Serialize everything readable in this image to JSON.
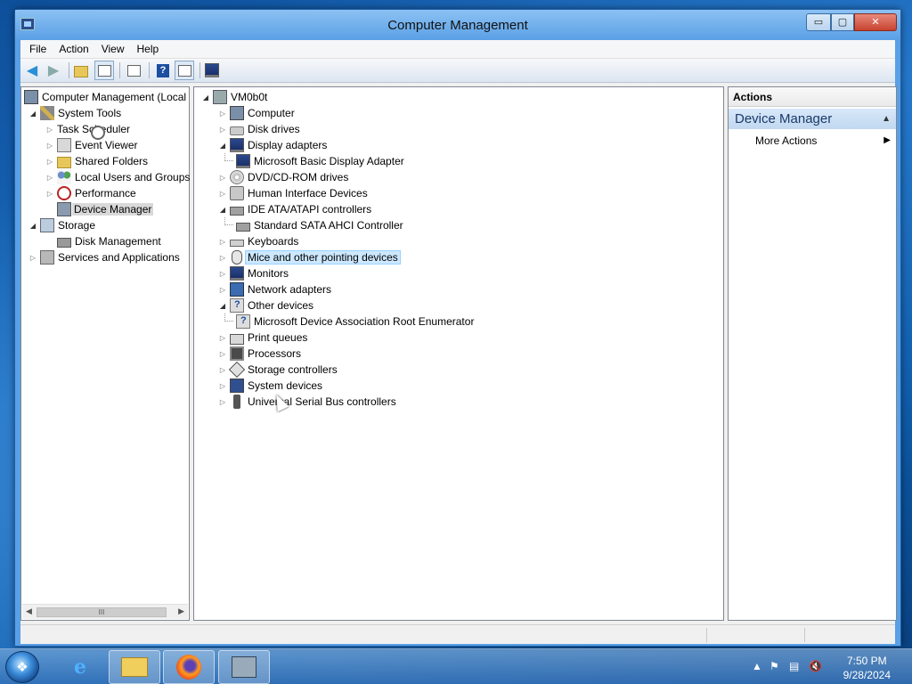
{
  "window": {
    "title": "Computer Management",
    "controls": {
      "minimize": "▭",
      "maximize": "▢",
      "close": "✕"
    }
  },
  "menu": [
    "File",
    "Action",
    "View",
    "Help"
  ],
  "toolbar": {
    "icons": [
      "back-arrow-icon",
      "forward-arrow-icon",
      "up-folder-icon",
      "show-hide-tree-icon",
      "properties-icon",
      "help-icon",
      "show-hide-action-pane-icon",
      "scan-hardware-icon"
    ]
  },
  "left_tree": {
    "root": "Computer Management (Local",
    "system_tools": "System Tools",
    "task_scheduler": "Task Scheduler",
    "event_viewer": "Event Viewer",
    "shared_folders": "Shared Folders",
    "local_users": "Local Users and Groups",
    "performance": "Performance",
    "device_manager": "Device Manager",
    "storage": "Storage",
    "disk_management": "Disk Management",
    "services_apps": "Services and Applications",
    "scroll_thumb": "III"
  },
  "device_tree": {
    "root": "VM0b0t",
    "items": [
      {
        "label": "Computer",
        "state": "collapsed",
        "icon": "computer-icon"
      },
      {
        "label": "Disk drives",
        "state": "collapsed",
        "icon": "disk-drive-icon"
      },
      {
        "label": "Display adapters",
        "state": "expanded",
        "icon": "display-adapter-icon"
      },
      {
        "label": "Microsoft Basic Display Adapter",
        "state": "child",
        "icon": "display-adapter-icon"
      },
      {
        "label": "DVD/CD-ROM drives",
        "state": "collapsed",
        "icon": "dvd-icon"
      },
      {
        "label": "Human Interface Devices",
        "state": "collapsed",
        "icon": "hid-icon"
      },
      {
        "label": "IDE ATA/ATAPI controllers",
        "state": "expanded",
        "icon": "ide-controller-icon"
      },
      {
        "label": "Standard SATA AHCI Controller",
        "state": "child",
        "icon": "ide-controller-icon"
      },
      {
        "label": "Keyboards",
        "state": "collapsed",
        "icon": "keyboard-icon"
      },
      {
        "label": "Mice and other pointing devices",
        "state": "collapsed",
        "icon": "mouse-icon",
        "selected": true
      },
      {
        "label": "Monitors",
        "state": "collapsed",
        "icon": "monitor-icon"
      },
      {
        "label": "Network adapters",
        "state": "collapsed",
        "icon": "network-adapter-icon"
      },
      {
        "label": "Other devices",
        "state": "expanded",
        "icon": "unknown-device-icon"
      },
      {
        "label": "Microsoft Device Association Root Enumerator",
        "state": "child",
        "icon": "unknown-device-icon"
      },
      {
        "label": "Print queues",
        "state": "collapsed",
        "icon": "printer-icon"
      },
      {
        "label": "Processors",
        "state": "collapsed",
        "icon": "processor-icon"
      },
      {
        "label": "Storage controllers",
        "state": "collapsed",
        "icon": "storage-controller-icon"
      },
      {
        "label": "System devices",
        "state": "collapsed",
        "icon": "system-device-icon"
      },
      {
        "label": "Universal Serial Bus controllers",
        "state": "collapsed",
        "icon": "usb-icon"
      }
    ]
  },
  "actions": {
    "header": "Actions",
    "group": "Device Manager",
    "more_actions": "More Actions"
  },
  "taskbar": {
    "apps": [
      "internet-explorer-icon",
      "file-explorer-icon",
      "firefox-icon",
      "computer-management-icon"
    ],
    "clock_time": "7:50 PM",
    "clock_date": "9/28/2024"
  }
}
